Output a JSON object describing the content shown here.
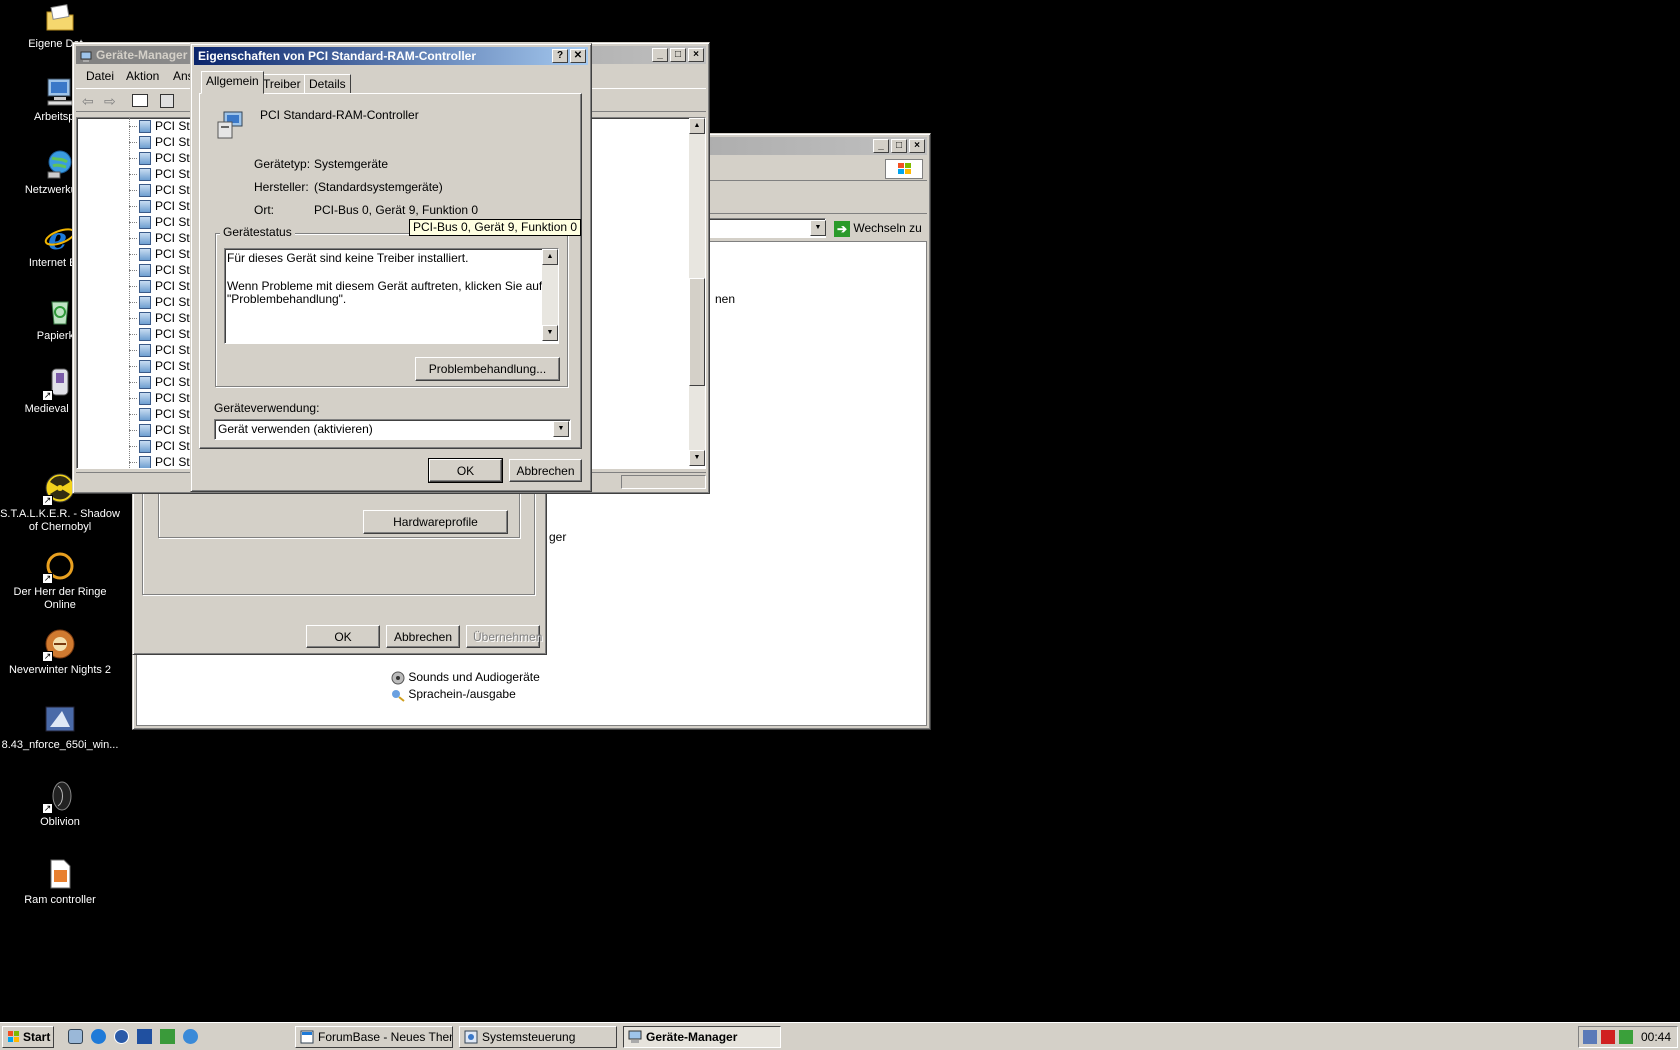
{
  "desktop": {
    "icons": [
      {
        "label": "Eigene Dat..."
      },
      {
        "label": "Arbeitspl..."
      },
      {
        "label": "Netzwerkum..."
      },
      {
        "label": "Internet Ex..."
      },
      {
        "label": "Papierk..."
      },
      {
        "label": "Medieval II T..."
      },
      {
        "label": "S.T.A.L.K.E.R. - Shadow of Chernobyl"
      },
      {
        "label": "Der Herr der Ringe Online"
      },
      {
        "label": "Neverwinter Nights 2"
      },
      {
        "label": "8.43_nforce_650i_win..."
      },
      {
        "label": "Oblivion"
      },
      {
        "label": "Ram controller"
      }
    ]
  },
  "control_panel": {
    "go_label": "Wechseln zu",
    "partial_text_1": "nen",
    "partial_text_2": "ger",
    "items": [
      {
        "label": "Sounds und Audiogeräte"
      },
      {
        "label": "Sprachein-/ausgabe"
      }
    ]
  },
  "system_props": {
    "hardware_profiles_button": "Hardwareprofile",
    "ok_button": "OK",
    "cancel_button": "Abbrechen",
    "apply_button": "Übernehmen"
  },
  "device_manager": {
    "title": "Geräte-Manager",
    "menu": [
      "Datei",
      "Aktion",
      "Ans"
    ],
    "tree_item": "PCI Sta"
  },
  "dialog": {
    "title": "Eigenschaften von PCI Standard-RAM-Controller",
    "help_button": "?",
    "close_button": "✕",
    "tabs": [
      "Allgemein",
      "Treiber",
      "Details"
    ],
    "device_name": "PCI Standard-RAM-Controller",
    "type_label": "Gerätetyp:",
    "type_value": "Systemgeräte",
    "manufacturer_label": "Hersteller:",
    "manufacturer_value": "(Standardsystemgeräte)",
    "location_label": "Ort:",
    "location_value": "PCI-Bus 0, Gerät 9, Funktion 0",
    "tooltip": "PCI-Bus 0, Gerät 9, Funktion 0",
    "status_group": "Gerätestatus",
    "status_line1": "Für dieses Gerät sind keine Treiber installiert.",
    "status_line2": "Wenn Probleme mit diesem Gerät auftreten, klicken Sie auf",
    "status_line3": "\"Problembehandlung\".",
    "troubleshoot_button": "Problembehandlung...",
    "usage_label": "Geräteverwendung:",
    "usage_value": "Gerät verwenden (aktivieren)",
    "ok_button": "OK",
    "cancel_button": "Abbrechen"
  },
  "taskbar": {
    "start_label": "Start",
    "tasks": [
      {
        "label": "ForumBase - Neues Them..."
      },
      {
        "label": "Systemsteuerung"
      },
      {
        "label": "Geräte-Manager"
      }
    ],
    "clock": "00:44"
  },
  "colors": {
    "desktop": "#000000",
    "face": "#d4d0c8",
    "title_active": "#0a246a",
    "title_inactive": "#808080"
  }
}
